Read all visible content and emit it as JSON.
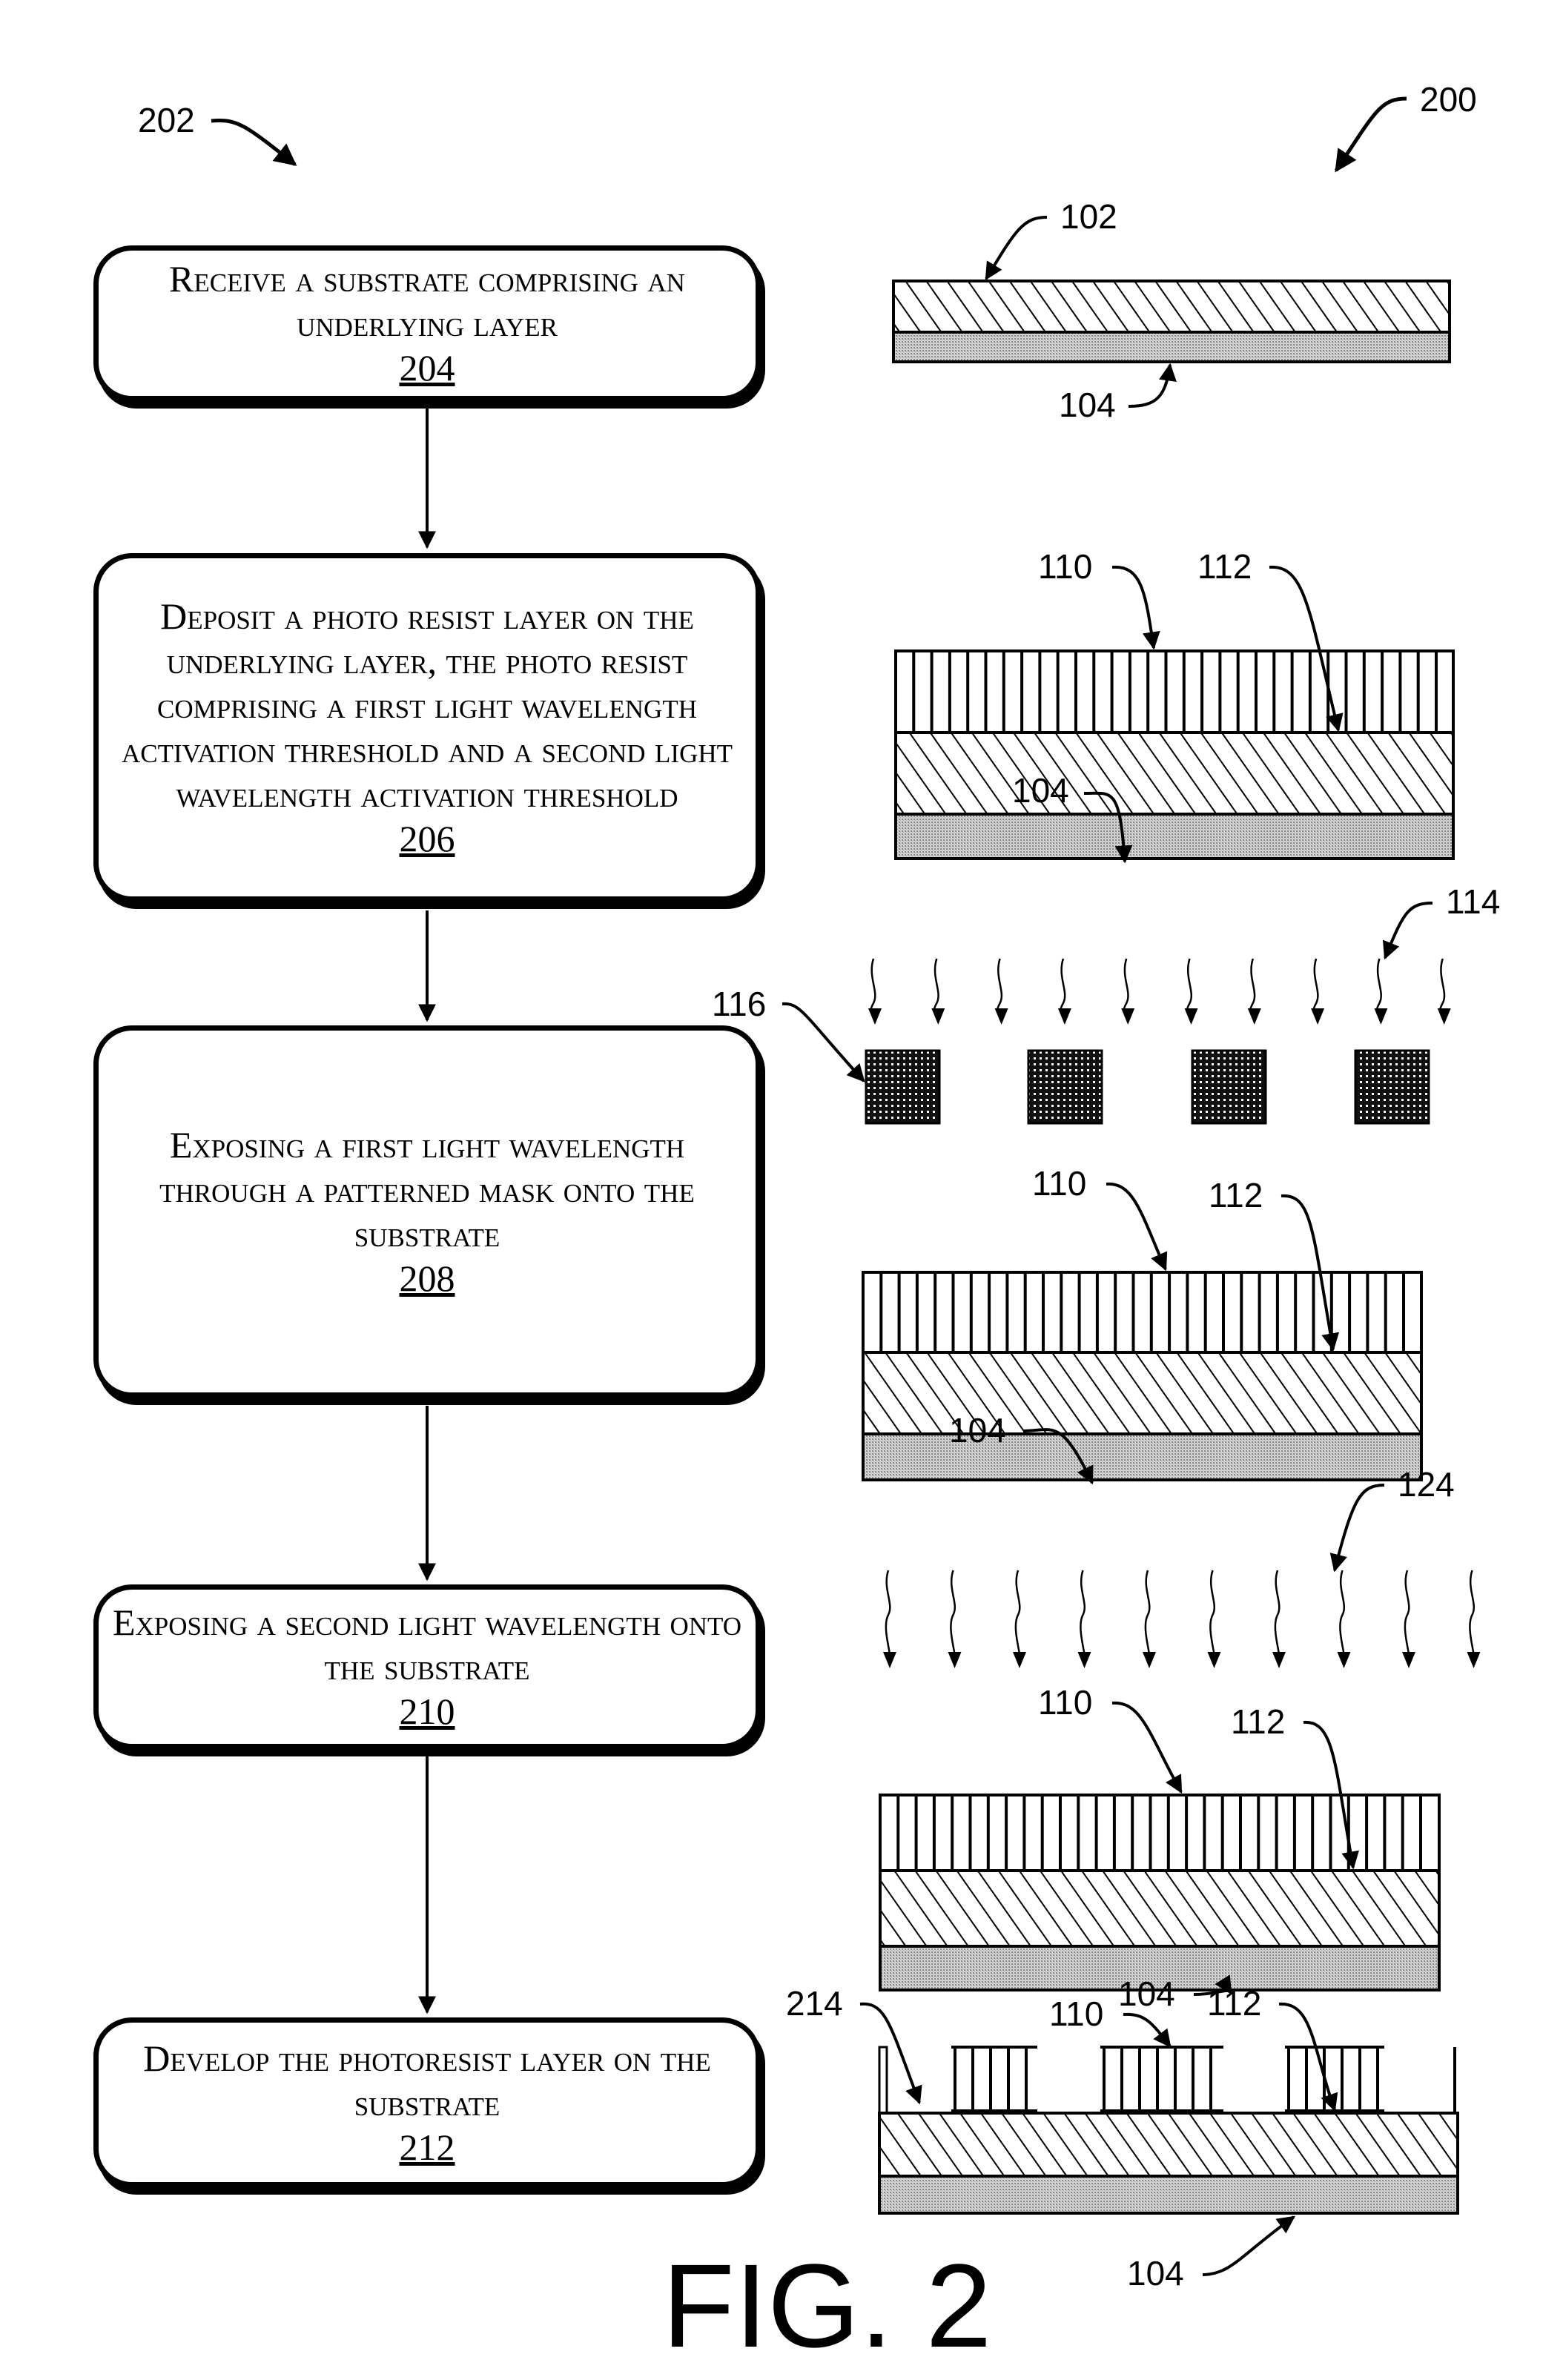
{
  "figure": {
    "title": "FIG. 2",
    "method_ref": "202",
    "apparatus_ref": "200"
  },
  "steps": [
    {
      "text": "Receive a substrate comprising an underlying layer",
      "ref": "204"
    },
    {
      "text": "Deposit a photo resist layer on the underlying layer, the photo resist comprising a first light wavelength activation threshold and a second light wavelength activation threshold",
      "ref": "206"
    },
    {
      "text": "Exposing a first light wavelength through a patterned mask onto the substrate",
      "ref": "208"
    },
    {
      "text": "Exposing a second light wavelength onto the substrate",
      "ref": "210"
    },
    {
      "text": "Develop the photoresist layer on the substrate",
      "ref": "212"
    }
  ],
  "stages": [
    {
      "labels": {
        "top_layer": "102",
        "substrate": "104"
      }
    },
    {
      "labels": {
        "resist": "110",
        "underlying": "112",
        "substrate": "104"
      }
    },
    {
      "labels": {
        "light": "114",
        "mask": "116",
        "resist": "110",
        "underlying": "112",
        "substrate": "104"
      }
    },
    {
      "labels": {
        "light": "124",
        "resist": "110",
        "underlying": "112",
        "substrate": "104"
      }
    },
    {
      "labels": {
        "opening": "214",
        "resist": "110",
        "underlying": "112",
        "substrate": "104"
      }
    }
  ],
  "colors": {
    "ink": "#000000",
    "substrate_fill": "#bdbdbd",
    "mask_fill": "#2b2b2b",
    "background": "#ffffff"
  }
}
